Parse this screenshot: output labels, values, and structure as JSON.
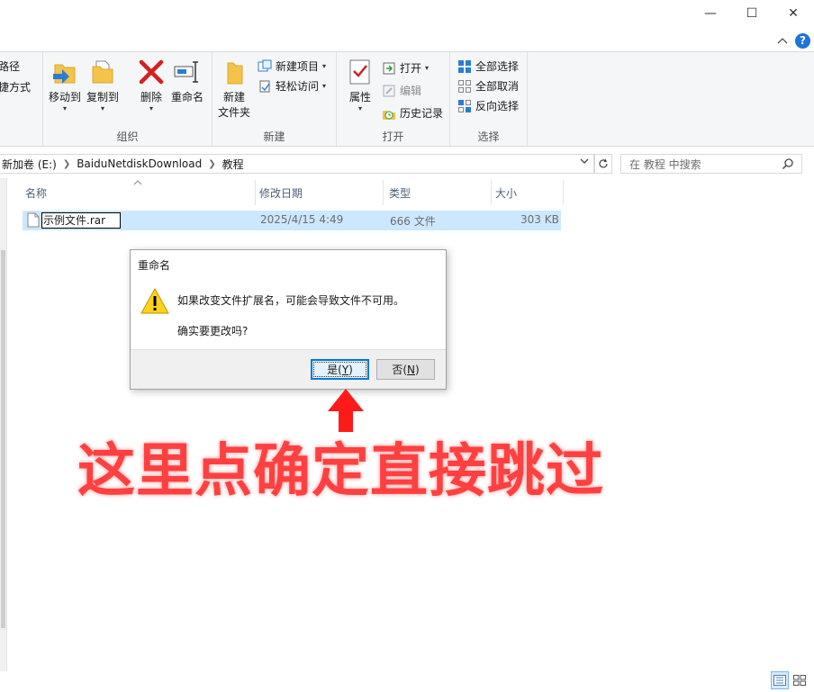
{
  "window": {
    "minimize_glyph": "—",
    "maximize_glyph": "☐",
    "close_glyph": "✕",
    "help_glyph": "?"
  },
  "ribbon": {
    "clipboard_partial": {
      "path_label": "路径",
      "shortcut_label": "快捷方式"
    },
    "organize": {
      "label": "组织",
      "move_to": "移动到",
      "copy_to": "复制到",
      "delete": "删除",
      "rename": "重命名"
    },
    "new": {
      "label": "新建",
      "new_folder_line1": "新建",
      "new_folder_line2": "文件夹",
      "new_item": "新建项目",
      "easy_access": "轻松访问"
    },
    "open": {
      "label": "打开",
      "properties": "属性",
      "open": "打开",
      "edit": "编辑",
      "history": "历史记录"
    },
    "select": {
      "label": "选择",
      "select_all": "全部选择",
      "select_none": "全部取消",
      "invert": "反向选择"
    }
  },
  "address": {
    "crumbs": [
      "新加卷 (E:)",
      "BaiduNetdiskDownload",
      "教程"
    ],
    "search_placeholder": "在 教程 中搜索"
  },
  "columns": {
    "name": "名称",
    "modified": "修改日期",
    "type": "类型",
    "size": "大小"
  },
  "files": [
    {
      "name": "示例文件.rar",
      "modified": "2025/4/15 4:49",
      "type": "666 文件",
      "size": "303 KB"
    }
  ],
  "dialog": {
    "title": "重命名",
    "message1": "如果改变文件扩展名，可能会导致文件不可用。",
    "message2": "确实要更改吗?",
    "yes_label": "是(",
    "yes_key": "Y",
    "yes_suffix": ")",
    "no_label": "否(",
    "no_key": "N",
    "no_suffix": ")"
  },
  "annotation": {
    "text": "这里点确定直接跳过",
    "color": "#ff4040"
  },
  "colors": {
    "selection": "#cce8ff",
    "accent": "#0078d7",
    "ribbon_bg": "#f5f6f7"
  }
}
